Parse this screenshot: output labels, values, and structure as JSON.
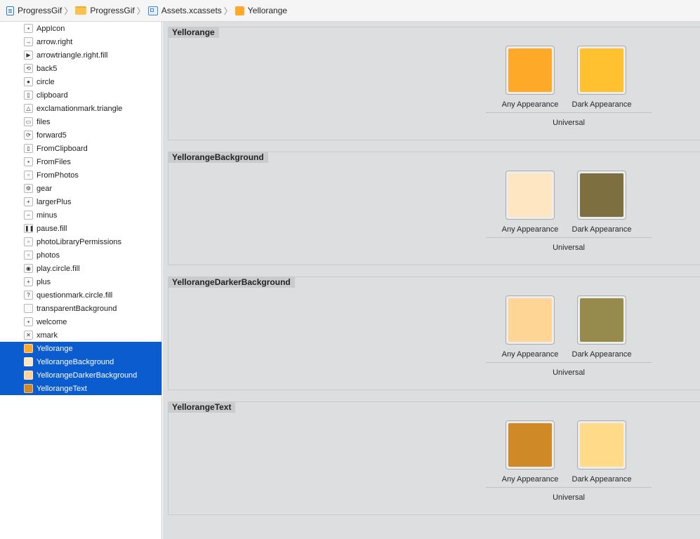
{
  "breadcrumb": {
    "project": "ProgressGif",
    "folder": "ProgressGif",
    "catalog": "Assets.xcassets",
    "asset": "Yellorange"
  },
  "sidebar": {
    "items": [
      {
        "label": "AppIcon",
        "icon": "app-icon-icon",
        "glyph": "▪",
        "selected": false
      },
      {
        "label": "arrow.right",
        "icon": "arrow-right-icon",
        "glyph": "→",
        "selected": false
      },
      {
        "label": "arrowtriangle.right.fill",
        "icon": "arrowtriangle-right-icon",
        "glyph": "▶",
        "selected": false
      },
      {
        "label": "back5",
        "icon": "back5-icon",
        "glyph": "⟲",
        "selected": false
      },
      {
        "label": "circle",
        "icon": "circle-icon",
        "glyph": "●",
        "selected": false
      },
      {
        "label": "clipboard",
        "icon": "clipboard-icon",
        "glyph": "▯",
        "selected": false
      },
      {
        "label": "exclamationmark.triangle",
        "icon": "exclamation-triangle-icon",
        "glyph": "△",
        "selected": false
      },
      {
        "label": "files",
        "icon": "files-icon",
        "glyph": "▭",
        "selected": false
      },
      {
        "label": "forward5",
        "icon": "forward5-icon",
        "glyph": "⟳",
        "selected": false
      },
      {
        "label": "FromClipboard",
        "icon": "from-clipboard-icon",
        "glyph": "▯",
        "selected": false
      },
      {
        "label": "FromFiles",
        "icon": "from-files-icon",
        "glyph": "▪",
        "selected": false
      },
      {
        "label": "FromPhotos",
        "icon": "from-photos-icon",
        "glyph": "▫",
        "selected": false
      },
      {
        "label": "gear",
        "icon": "gear-icon",
        "glyph": "⚙",
        "selected": false
      },
      {
        "label": "largerPlus",
        "icon": "larger-plus-icon",
        "glyph": "+",
        "selected": false
      },
      {
        "label": "minus",
        "icon": "minus-icon",
        "glyph": "−",
        "selected": false
      },
      {
        "label": "pause.fill",
        "icon": "pause-icon",
        "glyph": "❚❚",
        "selected": false
      },
      {
        "label": "photoLibraryPermissions",
        "icon": "photo-library-icon",
        "glyph": "▫",
        "selected": false
      },
      {
        "label": "photos",
        "icon": "photos-icon",
        "glyph": "▫",
        "selected": false
      },
      {
        "label": "play.circle.fill",
        "icon": "play-circle-icon",
        "glyph": "◉",
        "selected": false
      },
      {
        "label": "plus",
        "icon": "plus-icon",
        "glyph": "+",
        "selected": false
      },
      {
        "label": "questionmark.circle.fill",
        "icon": "questionmark-circle-icon",
        "glyph": "?",
        "selected": false
      },
      {
        "label": "transparentBackground",
        "icon": "transparent-background-icon",
        "glyph": "",
        "selected": false
      },
      {
        "label": "welcome",
        "icon": "welcome-icon",
        "glyph": "▪",
        "selected": false
      },
      {
        "label": "xmark",
        "icon": "xmark-icon",
        "glyph": "✕",
        "selected": false
      },
      {
        "label": "Yellorange",
        "icon": "color-swatch-icon",
        "glyph": "",
        "swatch": "#ffa929",
        "selected": true
      },
      {
        "label": "YellorangeBackground",
        "icon": "color-swatch-icon",
        "glyph": "",
        "swatch": "#ffe6c3",
        "selected": true
      },
      {
        "label": "YellorangeDarkerBackground",
        "icon": "color-swatch-icon",
        "glyph": "",
        "swatch": "#ffd596",
        "selected": true
      },
      {
        "label": "YellorangeText",
        "icon": "color-swatch-icon",
        "glyph": "",
        "swatch": "#cf8a27",
        "selected": true
      }
    ]
  },
  "color_sets": [
    {
      "name": "Yellorange",
      "any_label": "Any Appearance",
      "dark_label": "Dark Appearance",
      "group_label": "Universal",
      "any_color": "#ffa929",
      "dark_color": "#ffc130"
    },
    {
      "name": "YellorangeBackground",
      "any_label": "Any Appearance",
      "dark_label": "Dark Appearance",
      "group_label": "Universal",
      "any_color": "#ffe6c3",
      "dark_color": "#7d6f40"
    },
    {
      "name": "YellorangeDarkerBackground",
      "any_label": "Any Appearance",
      "dark_label": "Dark Appearance",
      "group_label": "Universal",
      "any_color": "#ffd596",
      "dark_color": "#968a4d"
    },
    {
      "name": "YellorangeText",
      "any_label": "Any Appearance",
      "dark_label": "Dark Appearance",
      "group_label": "Universal",
      "any_color": "#cf8a27",
      "dark_color": "#ffdb89"
    }
  ]
}
